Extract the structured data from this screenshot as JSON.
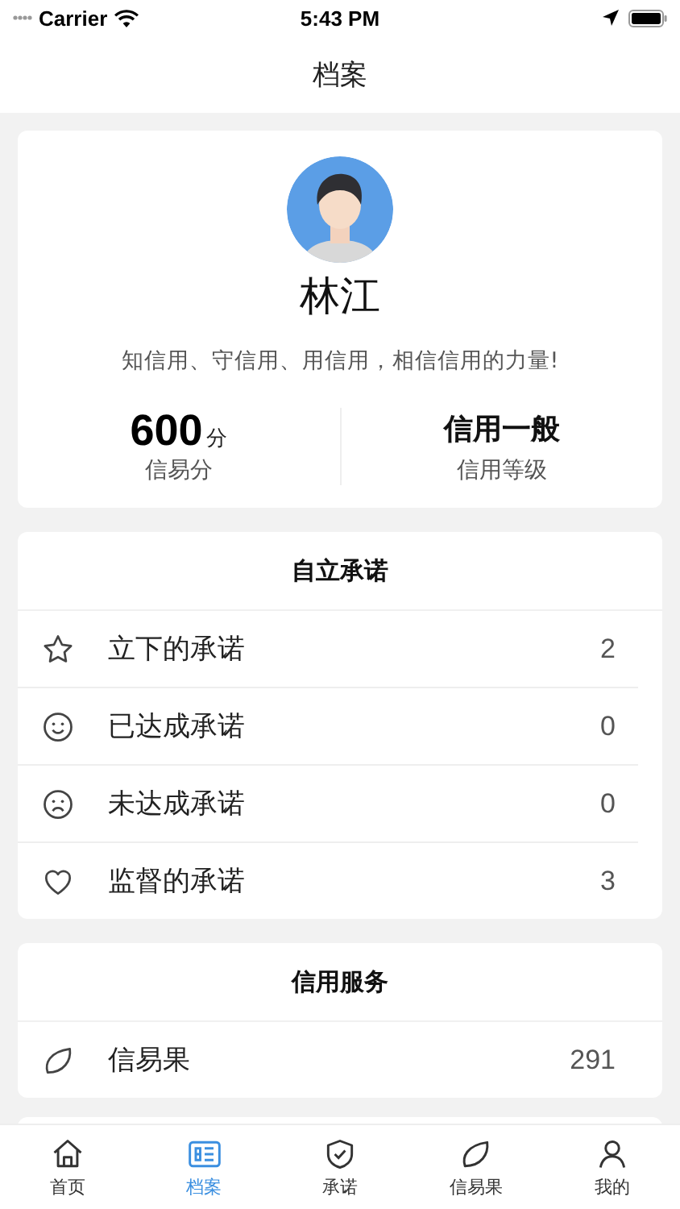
{
  "status_bar": {
    "carrier": "Carrier",
    "time": "5:43 PM"
  },
  "nav_bar": {
    "title": "档案"
  },
  "profile": {
    "name": "林江",
    "motto": "知信用、守信用、用信用，相信信用的力量!",
    "score": "600",
    "score_unit": "分",
    "score_label": "信易分",
    "level_value": "信用一般",
    "level_label": "信用等级"
  },
  "sections": [
    {
      "title": "自立承诺",
      "items": [
        {
          "label": "立下的承诺",
          "count": "2"
        },
        {
          "label": "已达成承诺",
          "count": "0"
        },
        {
          "label": "未达成承诺",
          "count": "0"
        },
        {
          "label": "监督的承诺",
          "count": "3"
        }
      ]
    },
    {
      "title": "信用服务",
      "items": [
        {
          "label": "信易果",
          "count": "291"
        }
      ]
    }
  ],
  "tab_bar": [
    {
      "label": "首页",
      "selected": false
    },
    {
      "label": "档案",
      "selected": true
    },
    {
      "label": "承诺",
      "selected": false
    },
    {
      "label": "信易果",
      "selected": false
    },
    {
      "label": "我的",
      "selected": false
    }
  ]
}
